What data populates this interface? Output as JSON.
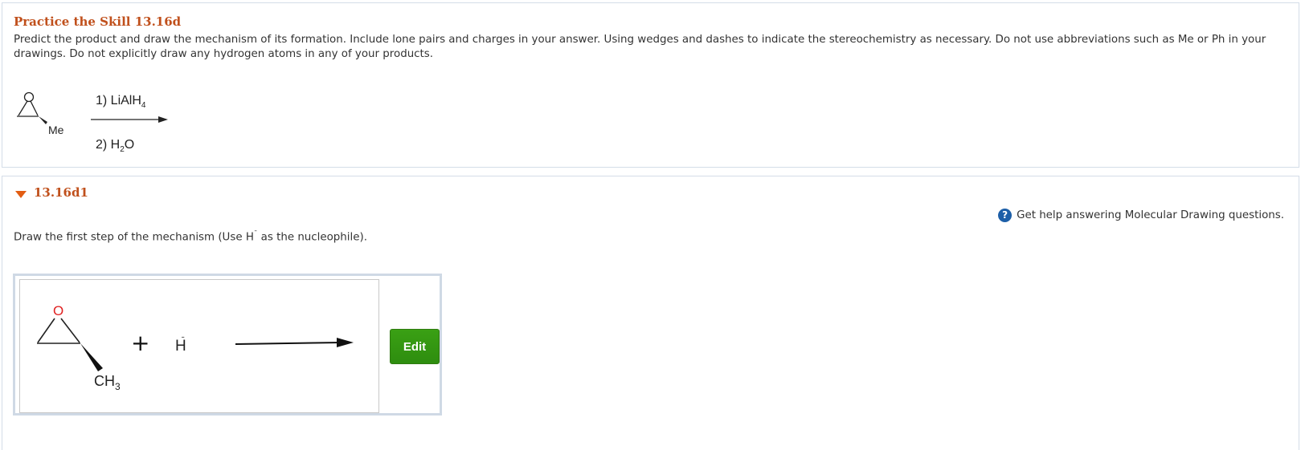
{
  "problem": {
    "title": "Practice the Skill 13.16d",
    "instructions": "Predict the product and draw the mechanism of its formation. Include lone pairs and charges in your answer. Using wedges and dashes to indicate the stereochemistry as necessary. Do not use abbreviations such as Me or Ph in your drawings. Do not explicitly draw any hydrogen atoms in any of your products.",
    "scheme": {
      "substituent": "Me",
      "reagent1": "1) LiAlH",
      "reagent1_sub": "4",
      "reagent2_pre": "2) H",
      "reagent2_sub": "2",
      "reagent2_post": "O"
    }
  },
  "part": {
    "label": "13.16d1",
    "help_link": "Get help answering Molecular Drawing questions.",
    "question_pre": "Draw the first step of the mechanism (Use H",
    "question_sup": "ˉ",
    "question_post": " as the nucleophile).",
    "drawing": {
      "oxygen": "O",
      "methyl": "CH",
      "methyl_sub": "3",
      "plus": "+",
      "hydride": "H",
      "hydride_charge": "ˉ"
    },
    "edit_label": "Edit"
  },
  "colors": {
    "accent": "#c0501c",
    "caret": "#e25d12",
    "edit": "#3aa014",
    "oxygen": "#e02020"
  }
}
